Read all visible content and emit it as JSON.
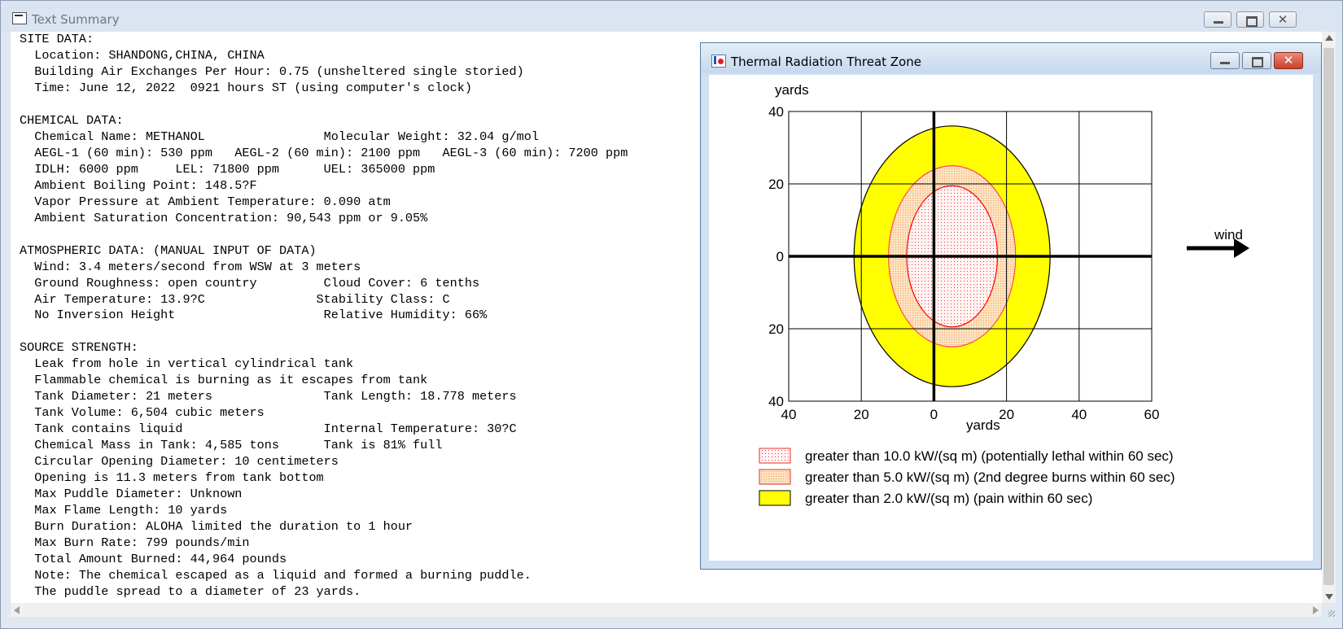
{
  "main_window": {
    "title": "Text Summary",
    "minimize_label": "",
    "maximize_label": "",
    "close_label": "✕"
  },
  "summary_lines": [
    "SITE DATA:",
    "  Location: SHANDONG,CHINA, CHINA",
    "  Building Air Exchanges Per Hour: 0.75 (unsheltered single storied)",
    "  Time: June 12, 2022  0921 hours ST (using computer's clock)",
    "",
    "CHEMICAL DATA:",
    "  Chemical Name: METHANOL                Molecular Weight: 32.04 g/mol",
    "  AEGL-1 (60 min): 530 ppm   AEGL-2 (60 min): 2100 ppm   AEGL-3 (60 min): 7200 ppm",
    "  IDLH: 6000 ppm     LEL: 71800 ppm      UEL: 365000 ppm",
    "  Ambient Boiling Point: 148.5?F",
    "  Vapor Pressure at Ambient Temperature: 0.090 atm",
    "  Ambient Saturation Concentration: 90,543 ppm or 9.05%",
    "",
    "ATMOSPHERIC DATA: (MANUAL INPUT OF DATA)",
    "  Wind: 3.4 meters/second from WSW at 3 meters",
    "  Ground Roughness: open country         Cloud Cover: 6 tenths",
    "  Air Temperature: 13.9?C               Stability Class: C",
    "  No Inversion Height                    Relative Humidity: 66%",
    "",
    "SOURCE STRENGTH:",
    "  Leak from hole in vertical cylindrical tank",
    "  Flammable chemical is burning as it escapes from tank",
    "  Tank Diameter: 21 meters               Tank Length: 18.778 meters",
    "  Tank Volume: 6,504 cubic meters",
    "  Tank contains liquid                   Internal Temperature: 30?C",
    "  Chemical Mass in Tank: 4,585 tons      Tank is 81% full",
    "  Circular Opening Diameter: 10 centimeters",
    "  Opening is 11.3 meters from tank bottom",
    "  Max Puddle Diameter: Unknown",
    "  Max Flame Length: 10 yards",
    "  Burn Duration: ALOHA limited the duration to 1 hour",
    "  Max Burn Rate: 799 pounds/min",
    "  Total Amount Burned: 44,964 pounds",
    "  Note: The chemical escaped as a liquid and formed a burning puddle.",
    "  The puddle spread to a diameter of 23 yards."
  ],
  "threat_window": {
    "title": "Thermal Radiation Threat Zone",
    "close_label": "✕",
    "wind_label": "wind"
  },
  "chart_data": {
    "type": "threat-zone",
    "xlabel": "yards",
    "ylabel": "yards",
    "x_ticks": [
      "40",
      "20",
      "0",
      "20",
      "40",
      "60"
    ],
    "y_ticks": [
      "40",
      "20",
      "0",
      "20",
      "40"
    ],
    "xlim": [
      -40,
      60
    ],
    "ylim": [
      -40,
      40
    ],
    "grid": true,
    "zones": [
      {
        "label": "greater than 2.0 kW/(sq m) (pain within 60 sec)",
        "center_x": 5,
        "half_width": 27,
        "half_height": 36,
        "fill": "#ffff00",
        "stroke": "#000000",
        "pattern": "solid"
      },
      {
        "label": "greater than 5.0 kW/(sq m) (2nd degree burns within 60 sec)",
        "center_x": 5,
        "half_width": 17.5,
        "half_height": 25,
        "fill": "#fde6c8",
        "stroke": "#ff4a4a",
        "pattern": "dots-orange"
      },
      {
        "label": "greater than 10.0 kW/(sq m) (potentially lethal within 60 sec)",
        "center_x": 5,
        "half_width": 12.5,
        "half_height": 19.5,
        "fill": "#fff0f0",
        "stroke": "#ff0000",
        "pattern": "dots-red"
      }
    ],
    "legend_order": [
      2,
      1,
      0
    ]
  }
}
